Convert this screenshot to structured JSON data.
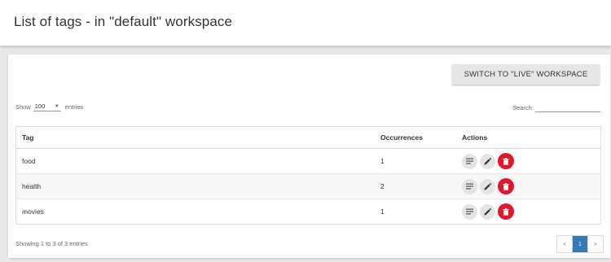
{
  "header": {
    "title": "List of tags - in \"default\" workspace"
  },
  "toolbar": {
    "switch_label": "Switch to \"live\" workspace"
  },
  "length_menu": {
    "prefix": "Show",
    "value": "100",
    "suffix": "entries"
  },
  "search": {
    "label": "Search:",
    "value": ""
  },
  "table": {
    "columns": [
      "Tag",
      "Occurrences",
      "Actions"
    ],
    "rows": [
      {
        "tag": "food",
        "occurrences": "1"
      },
      {
        "tag": "health",
        "occurrences": "2"
      },
      {
        "tag": "movies",
        "occurrences": "1"
      }
    ]
  },
  "footer": {
    "info": "Showing 1 to 3 of 3 entries"
  },
  "pagination": {
    "prev": "«",
    "current": "1",
    "next": "»"
  },
  "colors": {
    "delete": "#e0162b",
    "active_page": "#337ab7",
    "action_bg": "#e4e4e4"
  },
  "icons": {
    "view": "list-icon",
    "edit": "pencil-icon",
    "delete": "trash-icon"
  }
}
